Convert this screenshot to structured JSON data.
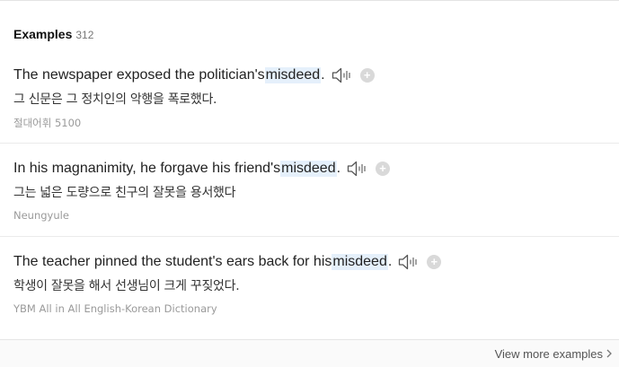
{
  "section": {
    "title": "Examples",
    "count": "312"
  },
  "examples": [
    {
      "en_before": "The newspaper exposed the politician's ",
      "en_highlight": "misdeed",
      "en_after": ".",
      "ko": "그 신문은 그 정치인의 악행을 폭로했다.",
      "source": "절대어휘 5100"
    },
    {
      "en_before": "In his magnanimity, he forgave his friend's ",
      "en_highlight": "misdeed",
      "en_after": ".",
      "ko": "그는 넓은 도량으로 친구의 잘못을 용서했다",
      "source": "Neungyule"
    },
    {
      "en_before": "The teacher pinned the student's ears back for his ",
      "en_highlight": "misdeed",
      "en_after": ".",
      "ko": "학생이 잘못을 해서 선생님이 크게 꾸짖었다.",
      "source": "YBM All in All English-Korean Dictionary"
    }
  ],
  "icons": {
    "speaker": "speaker-icon",
    "add": "add-icon",
    "chevron": "chevron-right-icon"
  },
  "footer": {
    "more_label": "View more examples"
  },
  "colors": {
    "highlight": "#e5f0fb",
    "source_text": "#9a9a9a",
    "add_button": "#d9d9d9"
  }
}
